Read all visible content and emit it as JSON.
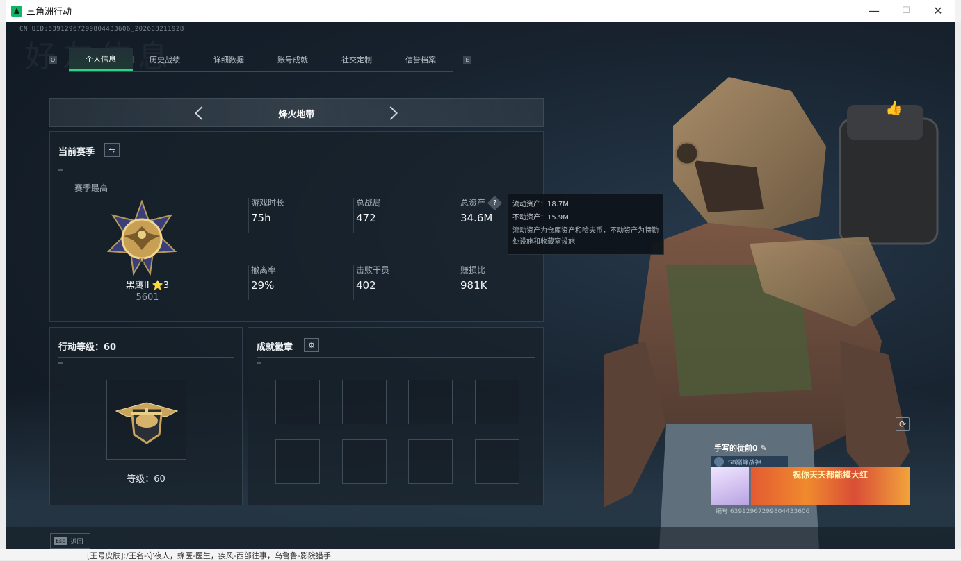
{
  "window": {
    "title": "三角洲行动",
    "minimize": "—",
    "maximize": "☐",
    "close": "✕"
  },
  "header": {
    "uid": "CN UID:6391296729980443360​6_202608211928",
    "bg_word": "好友信息"
  },
  "tabs": {
    "left_key": "Q",
    "right_key": "E",
    "items": [
      {
        "label": "个人信息",
        "active": true
      },
      {
        "label": "历史战绩",
        "active": false
      },
      {
        "label": "详细数据",
        "active": false
      },
      {
        "label": "账号成就",
        "active": false
      },
      {
        "label": "社交定制",
        "active": false
      },
      {
        "label": "信誉档案",
        "active": false
      }
    ]
  },
  "mode": {
    "title": "烽火地带"
  },
  "season": {
    "title": "当前赛季",
    "switch_icon": "⇋",
    "best_label": "赛季最高",
    "rank_name": "黑鹰II ⭐3",
    "rank_score": "5601",
    "stats": [
      {
        "label": "游戏时长",
        "value": "75h"
      },
      {
        "label": "总战局",
        "value": "472"
      },
      {
        "label": "总资产",
        "value": "34.6M"
      },
      {
        "label": "撤离率",
        "value": "29%"
      },
      {
        "label": "击败干员",
        "value": "402"
      },
      {
        "label": "赚损比",
        "value": "981K"
      }
    ],
    "help_icon": "?"
  },
  "tooltip": {
    "liquid": "流动资产：18.7M",
    "fixed": "不动资产：15.9M",
    "desc": "流动资产为仓库资产和哈夫币，不动资产为特勤处设施和收藏室设施"
  },
  "level": {
    "title": "行动等级：60",
    "level_text": "等级：60"
  },
  "badges": {
    "title": "成就徽章",
    "settings_icon": "⚙"
  },
  "profile_card": {
    "name": "手写的從前0",
    "edit_icon": "✎",
    "title": "S8巅峰战神",
    "banner_text": "祝你天天都能摸大红",
    "id": "编号 63912967299804433606"
  },
  "footer": {
    "esc_key": "Esc",
    "esc_label": "返回"
  },
  "below_text": "[王号皮肤]:/王名-守夜人，蜂医-医生，疾风-西部往事，乌鲁鲁-影院猎手",
  "icons": {
    "like": "👍",
    "refresh": "⟳"
  },
  "colors": {
    "accent": "#2bd48a",
    "background": "#17222e"
  }
}
